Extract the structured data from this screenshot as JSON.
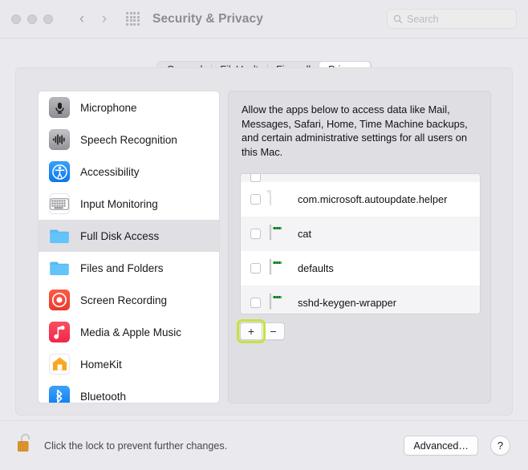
{
  "window": {
    "title": "Security & Privacy",
    "traffic_lights": [
      "close",
      "minimize",
      "zoom"
    ],
    "nav": {
      "back": "‹",
      "forward": "›",
      "grid_icon": "grid-view-icon"
    }
  },
  "search": {
    "placeholder": "Search",
    "value": "",
    "icon": "search-icon"
  },
  "tabs": [
    {
      "label": "General",
      "active": false
    },
    {
      "label": "FileVault",
      "active": false
    },
    {
      "label": "Firewall",
      "active": false
    },
    {
      "label": "Privacy",
      "active": true
    }
  ],
  "sidebar": {
    "items": [
      {
        "label": "Microphone",
        "icon": "microphone-icon",
        "selected": false
      },
      {
        "label": "Speech Recognition",
        "icon": "speech-recognition-icon",
        "selected": false
      },
      {
        "label": "Accessibility",
        "icon": "accessibility-icon",
        "selected": false
      },
      {
        "label": "Input Monitoring",
        "icon": "keyboard-icon",
        "selected": false
      },
      {
        "label": "Full Disk Access",
        "icon": "folder-icon",
        "selected": true
      },
      {
        "label": "Files and Folders",
        "icon": "folder-icon",
        "selected": false
      },
      {
        "label": "Screen Recording",
        "icon": "screen-recording-icon",
        "selected": false
      },
      {
        "label": "Media & Apple Music",
        "icon": "music-note-icon",
        "selected": false
      },
      {
        "label": "HomeKit",
        "icon": "homekit-icon",
        "selected": false
      },
      {
        "label": "Bluetooth",
        "icon": "bluetooth-icon",
        "selected": false
      }
    ]
  },
  "right_pane": {
    "description": "Allow the apps below to access data like Mail, Messages, Safari, Home, Time Machine backups, and certain administrative settings for all users on this Mac.",
    "app_list": [
      {
        "name": "com.microsoft.autoupdate.helper",
        "icon": "document-icon",
        "checked": false
      },
      {
        "name": "cat",
        "icon": "terminal-icon",
        "checked": false
      },
      {
        "name": "defaults",
        "icon": "terminal-icon",
        "checked": false
      },
      {
        "name": "sshd-keygen-wrapper",
        "icon": "terminal-icon",
        "checked": false
      }
    ],
    "add_button": "+",
    "remove_button": "−",
    "highlight_color": "#c3e53b"
  },
  "bottom": {
    "lock_icon": "unlocked-padlock-icon",
    "lock_text": "Click the lock to prevent further changes.",
    "advanced_label": "Advanced…",
    "help_label": "?"
  }
}
